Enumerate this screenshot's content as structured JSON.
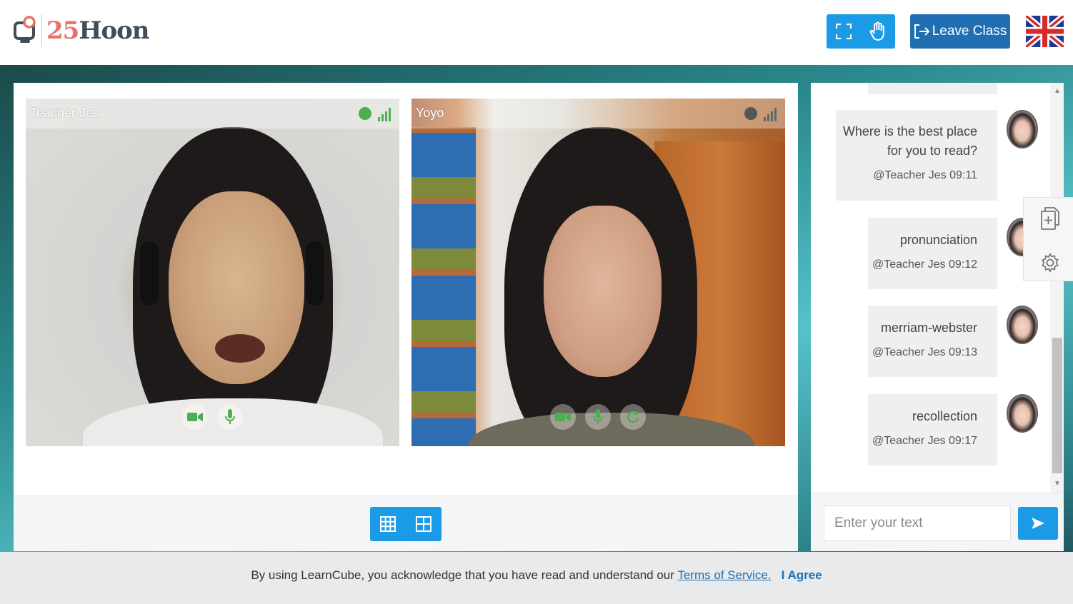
{
  "header": {
    "logo_number": "25",
    "logo_word": "Hoon",
    "fullscreen_icon": "fullscreen-icon",
    "raise_hand_icon": "hand-icon",
    "leave_label": "Leave Class",
    "language_flag": "uk-flag"
  },
  "videos": [
    {
      "name": "Teacher Jes",
      "status_color": "#4caf50",
      "signal_color": "#4caf50"
    },
    {
      "name": "Yoyo",
      "status_color": "#555555",
      "signal_color": "#666666"
    }
  ],
  "layout_buttons": [
    "grid-3x3-icon",
    "grid-2x2-icon"
  ],
  "chat": {
    "messages": [
      {
        "text_lines": [
          "Where is the best place",
          "for you to read?"
        ],
        "meta": "@Teacher Jes 09:11"
      },
      {
        "text_lines": [
          "pronunciation"
        ],
        "meta": "@Teacher Jes 09:12"
      },
      {
        "text_lines": [
          "merriam-webster"
        ],
        "meta": "@Teacher Jes 09:13"
      },
      {
        "text_lines": [
          "recollection"
        ],
        "meta": "@Teacher Jes 09:17"
      }
    ],
    "input_placeholder": "Enter your text"
  },
  "cookie": {
    "text": "By using LearnCube, you acknowledge that you have read and understand our ",
    "link": "Terms of Service.",
    "agree": "I Agree"
  },
  "colors": {
    "primary": "#1b9be6",
    "leave": "#1f6fb2",
    "active_green": "#4caf50"
  }
}
